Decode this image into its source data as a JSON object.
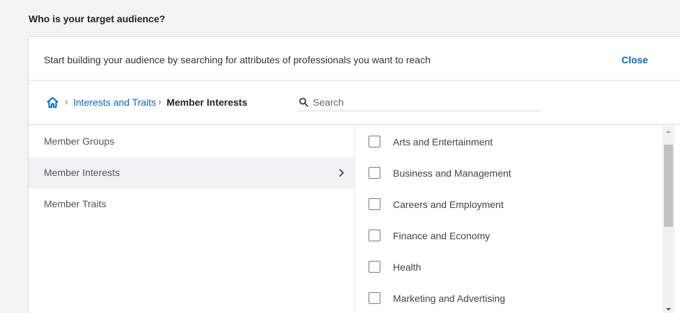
{
  "section": {
    "title": "Who is your target audience?"
  },
  "panel": {
    "intro": "Start building your audience by searching for attributes of professionals you want to reach",
    "close_label": "Close"
  },
  "breadcrumb": {
    "home_icon": "home-icon",
    "items": [
      {
        "label": "Interests and Traits"
      },
      {
        "label": "Member Interests"
      }
    ]
  },
  "search": {
    "icon": "search-icon",
    "placeholder": "Search",
    "value": ""
  },
  "categories": [
    {
      "label": "Member Groups",
      "active": false
    },
    {
      "label": "Member Interests",
      "active": true
    },
    {
      "label": "Member Traits",
      "active": false
    }
  ],
  "options": [
    {
      "label": "Arts and Entertainment",
      "checked": false
    },
    {
      "label": "Business and Management",
      "checked": false
    },
    {
      "label": "Careers and Employment",
      "checked": false
    },
    {
      "label": "Finance and Economy",
      "checked": false
    },
    {
      "label": "Health",
      "checked": false
    },
    {
      "label": "Marketing and Advertising",
      "checked": false
    }
  ],
  "colors": {
    "accent": "#0a66c2",
    "active_row": "#f0f2f4",
    "background": "#f3f3f3"
  }
}
